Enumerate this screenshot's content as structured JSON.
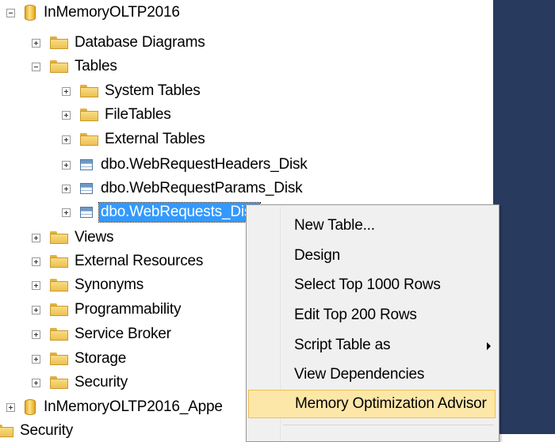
{
  "tree": {
    "database": "InMemoryOLTP2016",
    "database_diagrams": "Database Diagrams",
    "tables": "Tables",
    "system_tables": "System Tables",
    "file_tables": "FileTables",
    "external_tables": "External Tables",
    "table1": "dbo.WebRequestHeaders_Disk",
    "table2": "dbo.WebRequestParams_Disk",
    "table3": "dbo.WebRequests_Disk",
    "views": "Views",
    "external_resources": "External Resources",
    "synonyms": "Synonyms",
    "programmability": "Programmability",
    "service_broker": "Service Broker",
    "storage": "Storage",
    "security": "Security",
    "database2": "InMemoryOLTP2016_Appe",
    "security_root": "Security"
  },
  "context_menu": {
    "items": [
      "New Table...",
      "Design",
      "Select Top 1000 Rows",
      "Edit Top 200 Rows",
      "Script Table as",
      "View Dependencies",
      "Memory Optimization Advisor"
    ]
  }
}
